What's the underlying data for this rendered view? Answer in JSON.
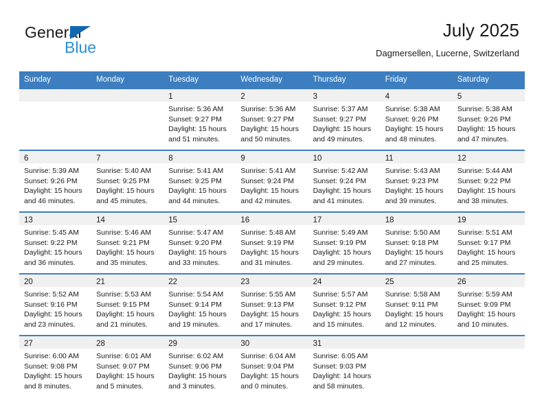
{
  "brand": {
    "word_one": "General",
    "word_two": "Blue",
    "triangle_color": "#1267b2",
    "blue_text_color": "#2b8fd4"
  },
  "header": {
    "title": "July 2025",
    "subtitle": "Dagmersellen, Lucerne, Switzerland"
  },
  "theme": {
    "header_blue": "#3c7ebf",
    "daynum_band": "#f0f0f0",
    "cell_background": "#ffffff",
    "text_color": "#1a1a1a"
  },
  "calendar": {
    "weekday_headers": [
      "Sunday",
      "Monday",
      "Tuesday",
      "Wednesday",
      "Thursday",
      "Friday",
      "Saturday"
    ],
    "weeks": [
      [
        {
          "day": "",
          "lines": []
        },
        {
          "day": "",
          "lines": []
        },
        {
          "day": "1",
          "lines": [
            "Sunrise: 5:36 AM",
            "Sunset: 9:27 PM",
            "Daylight: 15 hours",
            "and 51 minutes."
          ]
        },
        {
          "day": "2",
          "lines": [
            "Sunrise: 5:36 AM",
            "Sunset: 9:27 PM",
            "Daylight: 15 hours",
            "and 50 minutes."
          ]
        },
        {
          "day": "3",
          "lines": [
            "Sunrise: 5:37 AM",
            "Sunset: 9:27 PM",
            "Daylight: 15 hours",
            "and 49 minutes."
          ]
        },
        {
          "day": "4",
          "lines": [
            "Sunrise: 5:38 AM",
            "Sunset: 9:26 PM",
            "Daylight: 15 hours",
            "and 48 minutes."
          ]
        },
        {
          "day": "5",
          "lines": [
            "Sunrise: 5:38 AM",
            "Sunset: 9:26 PM",
            "Daylight: 15 hours",
            "and 47 minutes."
          ]
        }
      ],
      [
        {
          "day": "6",
          "lines": [
            "Sunrise: 5:39 AM",
            "Sunset: 9:26 PM",
            "Daylight: 15 hours",
            "and 46 minutes."
          ]
        },
        {
          "day": "7",
          "lines": [
            "Sunrise: 5:40 AM",
            "Sunset: 9:25 PM",
            "Daylight: 15 hours",
            "and 45 minutes."
          ]
        },
        {
          "day": "8",
          "lines": [
            "Sunrise: 5:41 AM",
            "Sunset: 9:25 PM",
            "Daylight: 15 hours",
            "and 44 minutes."
          ]
        },
        {
          "day": "9",
          "lines": [
            "Sunrise: 5:41 AM",
            "Sunset: 9:24 PM",
            "Daylight: 15 hours",
            "and 42 minutes."
          ]
        },
        {
          "day": "10",
          "lines": [
            "Sunrise: 5:42 AM",
            "Sunset: 9:24 PM",
            "Daylight: 15 hours",
            "and 41 minutes."
          ]
        },
        {
          "day": "11",
          "lines": [
            "Sunrise: 5:43 AM",
            "Sunset: 9:23 PM",
            "Daylight: 15 hours",
            "and 39 minutes."
          ]
        },
        {
          "day": "12",
          "lines": [
            "Sunrise: 5:44 AM",
            "Sunset: 9:22 PM",
            "Daylight: 15 hours",
            "and 38 minutes."
          ]
        }
      ],
      [
        {
          "day": "13",
          "lines": [
            "Sunrise: 5:45 AM",
            "Sunset: 9:22 PM",
            "Daylight: 15 hours",
            "and 36 minutes."
          ]
        },
        {
          "day": "14",
          "lines": [
            "Sunrise: 5:46 AM",
            "Sunset: 9:21 PM",
            "Daylight: 15 hours",
            "and 35 minutes."
          ]
        },
        {
          "day": "15",
          "lines": [
            "Sunrise: 5:47 AM",
            "Sunset: 9:20 PM",
            "Daylight: 15 hours",
            "and 33 minutes."
          ]
        },
        {
          "day": "16",
          "lines": [
            "Sunrise: 5:48 AM",
            "Sunset: 9:19 PM",
            "Daylight: 15 hours",
            "and 31 minutes."
          ]
        },
        {
          "day": "17",
          "lines": [
            "Sunrise: 5:49 AM",
            "Sunset: 9:19 PM",
            "Daylight: 15 hours",
            "and 29 minutes."
          ]
        },
        {
          "day": "18",
          "lines": [
            "Sunrise: 5:50 AM",
            "Sunset: 9:18 PM",
            "Daylight: 15 hours",
            "and 27 minutes."
          ]
        },
        {
          "day": "19",
          "lines": [
            "Sunrise: 5:51 AM",
            "Sunset: 9:17 PM",
            "Daylight: 15 hours",
            "and 25 minutes."
          ]
        }
      ],
      [
        {
          "day": "20",
          "lines": [
            "Sunrise: 5:52 AM",
            "Sunset: 9:16 PM",
            "Daylight: 15 hours",
            "and 23 minutes."
          ]
        },
        {
          "day": "21",
          "lines": [
            "Sunrise: 5:53 AM",
            "Sunset: 9:15 PM",
            "Daylight: 15 hours",
            "and 21 minutes."
          ]
        },
        {
          "day": "22",
          "lines": [
            "Sunrise: 5:54 AM",
            "Sunset: 9:14 PM",
            "Daylight: 15 hours",
            "and 19 minutes."
          ]
        },
        {
          "day": "23",
          "lines": [
            "Sunrise: 5:55 AM",
            "Sunset: 9:13 PM",
            "Daylight: 15 hours",
            "and 17 minutes."
          ]
        },
        {
          "day": "24",
          "lines": [
            "Sunrise: 5:57 AM",
            "Sunset: 9:12 PM",
            "Daylight: 15 hours",
            "and 15 minutes."
          ]
        },
        {
          "day": "25",
          "lines": [
            "Sunrise: 5:58 AM",
            "Sunset: 9:11 PM",
            "Daylight: 15 hours",
            "and 12 minutes."
          ]
        },
        {
          "day": "26",
          "lines": [
            "Sunrise: 5:59 AM",
            "Sunset: 9:09 PM",
            "Daylight: 15 hours",
            "and 10 minutes."
          ]
        }
      ],
      [
        {
          "day": "27",
          "lines": [
            "Sunrise: 6:00 AM",
            "Sunset: 9:08 PM",
            "Daylight: 15 hours",
            "and 8 minutes."
          ]
        },
        {
          "day": "28",
          "lines": [
            "Sunrise: 6:01 AM",
            "Sunset: 9:07 PM",
            "Daylight: 15 hours",
            "and 5 minutes."
          ]
        },
        {
          "day": "29",
          "lines": [
            "Sunrise: 6:02 AM",
            "Sunset: 9:06 PM",
            "Daylight: 15 hours",
            "and 3 minutes."
          ]
        },
        {
          "day": "30",
          "lines": [
            "Sunrise: 6:04 AM",
            "Sunset: 9:04 PM",
            "Daylight: 15 hours",
            "and 0 minutes."
          ]
        },
        {
          "day": "31",
          "lines": [
            "Sunrise: 6:05 AM",
            "Sunset: 9:03 PM",
            "Daylight: 14 hours",
            "and 58 minutes."
          ]
        },
        {
          "day": "",
          "lines": []
        },
        {
          "day": "",
          "lines": []
        }
      ]
    ]
  }
}
